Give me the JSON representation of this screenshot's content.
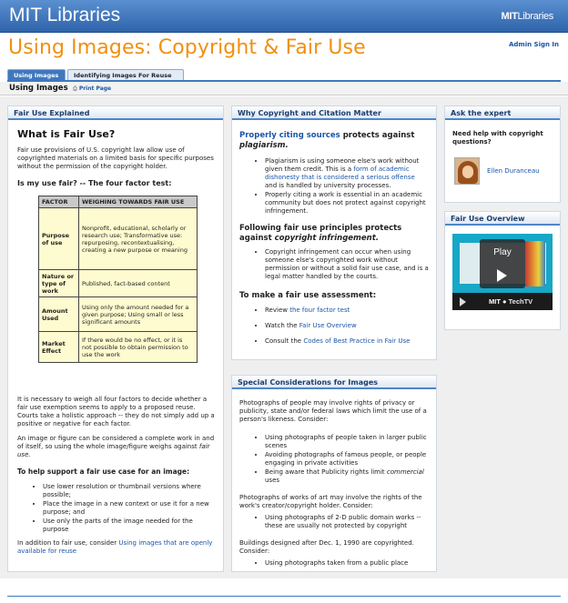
{
  "header": {
    "brand": "MIT Libraries",
    "logo_bold": "MIT",
    "logo_rest": "Libraries"
  },
  "page_title": "Using Images: Copyright & Fair Use",
  "admin_link": "Admin Sign In",
  "tabs": [
    {
      "label": "Using Images",
      "active": true
    },
    {
      "label": "Identifying Images For Reuse",
      "active": false
    }
  ],
  "subnav": {
    "page_name": "Using Images",
    "print_label": "Print Page"
  },
  "fair_use": {
    "header": "Fair Use Explained",
    "heading": "What is Fair Use?",
    "intro": "Fair use provisions of U.S. copyright law allow use of copyrighted materials on a limited basis for specific purposes without the permission of the copyright holder.",
    "question": "Is my use fair? -- The four factor test:",
    "table_headers": [
      "FACTOR",
      "WEIGHING TOWARDS FAIR USE"
    ],
    "table_rows": [
      {
        "factor": "Purpose of use",
        "weighing": "Nonprofit, educational, scholarly or research use; Transformative use: repurposing, recontextualising, creating a new purpose or meaning"
      },
      {
        "factor": "Nature or type of work",
        "weighing": "Published, fact-based content"
      },
      {
        "factor": "Amount Used",
        "weighing": "Using only the amount needed for a given purpose; Using small or less significant amounts"
      },
      {
        "factor": "Market Effect",
        "weighing": "If there would be no effect, or it is not possible to obtain permission to use the work"
      }
    ],
    "para_weigh": "It is necessary to weigh all four factors to decide whether a fair use exemption seems to apply to a proposed reuse. Courts take a holistic approach -- they do not simply add up a positive or negative for each factor.",
    "para_image_a": "An image or figure can be considered a complete work in and of itself, so using the whole image/figure weighs against ",
    "para_image_b": "fair use.",
    "help_heading": "To help support a fair use case for an image:",
    "help_items": [
      "Use lower resolution or thumbnail versions where possible;",
      "Place the image in a new context or use it for a new purpose; and",
      "Use only the parts of the image needed for the purpose"
    ],
    "footer_text": "In addition to fair use, consider ",
    "footer_link": "Using images that are openly available for reuse"
  },
  "why": {
    "header": "Why Copyright and Citation Matter",
    "h1_link": "Properly citing sources",
    "h1_text": " protects against ",
    "h1_italic": "plagiarism.",
    "list1": [
      {
        "before": "Plagiarism is using someone else's work without given them credit. This is a ",
        "link": "form of academic dishonesty that is considered a serious offense",
        "after": " and is handled by university processes."
      },
      {
        "before": "Properly citing a work is essential in an academic community but does not protect against copyright infringement.",
        "link": "",
        "after": ""
      }
    ],
    "h2_text": "Following fair use principles protects against ",
    "h2_italic": "copyright infringement.",
    "list2": [
      "Copyright infringement can occur when using someone else's copyrighted work without permission or without a solid fair use case, and is a legal matter handled by the courts."
    ],
    "h3": "To make a fair use assessment:",
    "list3": [
      {
        "before": "Review ",
        "link": "the four factor test"
      },
      {
        "before": "Watch the ",
        "link": "Fair Use Overview"
      },
      {
        "before": "Consult the ",
        "link": "Codes of Best Practice in Fair Use"
      }
    ]
  },
  "special": {
    "header": "Special Considerations for Images",
    "p1": "Photographs of people may involve rights of privacy or publicity, state and/or federal laws which limit the use of a person's likeness.  Consider:",
    "list1": [
      "Using photographs of people taken in larger public scenes",
      "Avoiding photographs of famous people, or people engaging in private activities"
    ],
    "item3_a": "Being aware that Publicity rights limit ",
    "item3_b": "commercial",
    "item3_c": " uses",
    "p2": "Photographs of works of art may involve the rights of the work's creator/copyright holder.  Consider:",
    "list2": [
      "Using photographs of 2-D public domain works -- these are usually not protected by copyright"
    ],
    "p3": "Buildings designed after Dec. 1, 1990 are copyrighted. Consider:",
    "list3": [
      "Using photographs taken from a public place"
    ]
  },
  "expert": {
    "header": "Ask the expert",
    "question": "Need help with copyright questions?",
    "name": "Ellen Duranceau"
  },
  "video": {
    "header": "Fair Use Overview",
    "play_label": "Play",
    "brand_a": "MIT",
    "brand_b": "TechTV"
  },
  "colors": {
    "accent": "#f09010",
    "primary_blue": "#3f78bf",
    "link": "#1a55a8",
    "table_cell": "#fffbd0"
  }
}
